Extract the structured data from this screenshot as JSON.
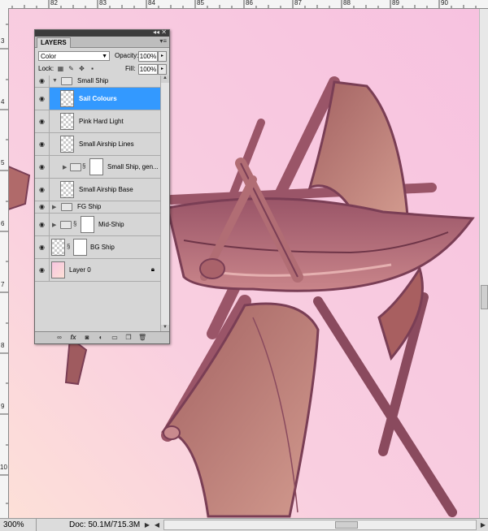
{
  "ruler": {
    "top_labels": [
      "82",
      "83",
      "84",
      "85",
      "86",
      "87",
      "88",
      "89",
      "90"
    ],
    "left_labels": [
      "3",
      "4",
      "5",
      "6",
      "7",
      "8",
      "9",
      "10"
    ]
  },
  "panel": {
    "tab": "LAYERS",
    "blend_mode": "Color",
    "opacity_label": "Opacity:",
    "opacity_value": "100%",
    "lock_label": "Lock:",
    "fill_label": "Fill:",
    "fill_value": "100%",
    "layers": [
      {
        "name": "Small Ship"
      },
      {
        "name": "Sail Colours",
        "selected": true
      },
      {
        "name": "Pink Hard Light"
      },
      {
        "name": "Small Airship Lines"
      },
      {
        "name": "Small Ship, gen..."
      },
      {
        "name": "Small Airship Base"
      },
      {
        "name": "FG Ship"
      },
      {
        "name": "Mid-Ship"
      },
      {
        "name": "BG Ship"
      },
      {
        "name": "Layer 0"
      }
    ],
    "bottom_icons": [
      "link-icon",
      "fx-icon",
      "mask-icon",
      "adjustment-icon",
      "group-icon",
      "new-layer-icon",
      "trash-icon"
    ]
  },
  "status": {
    "zoom": "300%",
    "doc": "Doc: 50.1M/715.3M"
  },
  "colors": {
    "canvas_bg": "#f6c4e0",
    "ship_dark": "#7a3e55",
    "ship_mid": "#a65e6c",
    "sail": "#b26d6d",
    "highlight": "#3399ff"
  }
}
